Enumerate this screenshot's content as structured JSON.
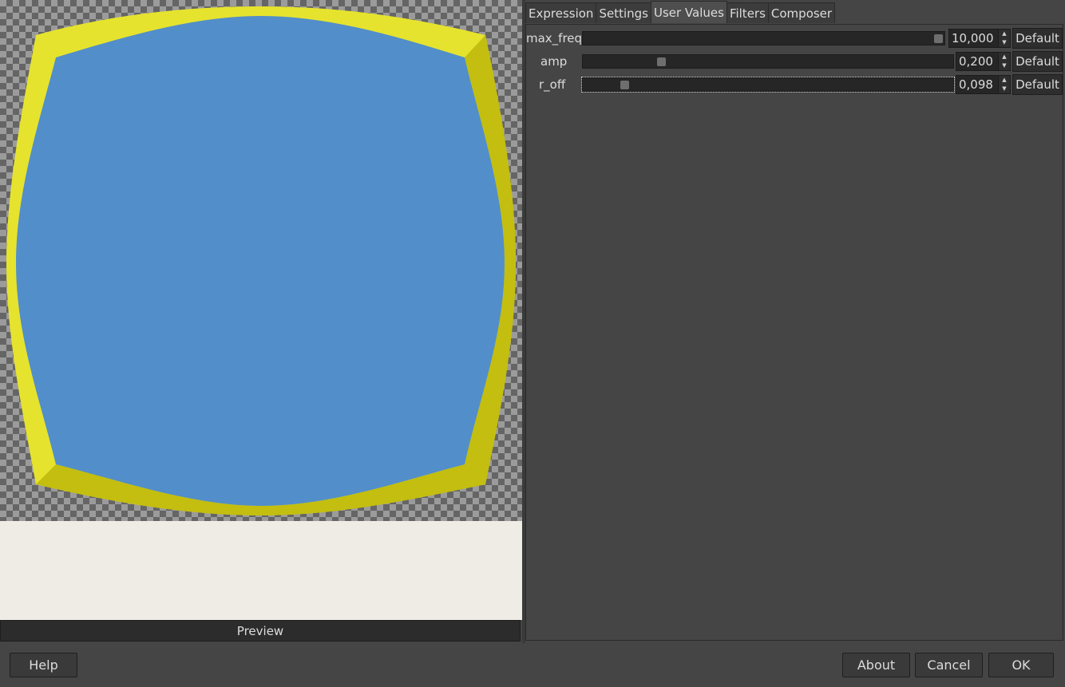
{
  "tabs": [
    {
      "label": "Expression"
    },
    {
      "label": "Settings"
    },
    {
      "label": "User Values",
      "active": true
    },
    {
      "label": "Filters"
    },
    {
      "label": "Composer"
    }
  ],
  "user_values": [
    {
      "name": "max_freq",
      "value": "10,000",
      "fraction": 1.0,
      "default_label": "Default"
    },
    {
      "name": "amp",
      "value": "0,200",
      "fraction": 0.2,
      "default_label": "Default"
    },
    {
      "name": "r_off",
      "value": "0,098",
      "fraction": 0.098,
      "default_label": "Default",
      "focused": true
    }
  ],
  "preview": {
    "button_label": "Preview",
    "fill_color": "#528ec9",
    "border_color": "#e6e32e",
    "border_shadow_color": "#c3be0f"
  },
  "footer": {
    "help_label": "Help",
    "about_label": "About",
    "cancel_label": "Cancel",
    "ok_label": "OK"
  },
  "icons": {
    "spin_up": "▲",
    "spin_down": "▼"
  }
}
